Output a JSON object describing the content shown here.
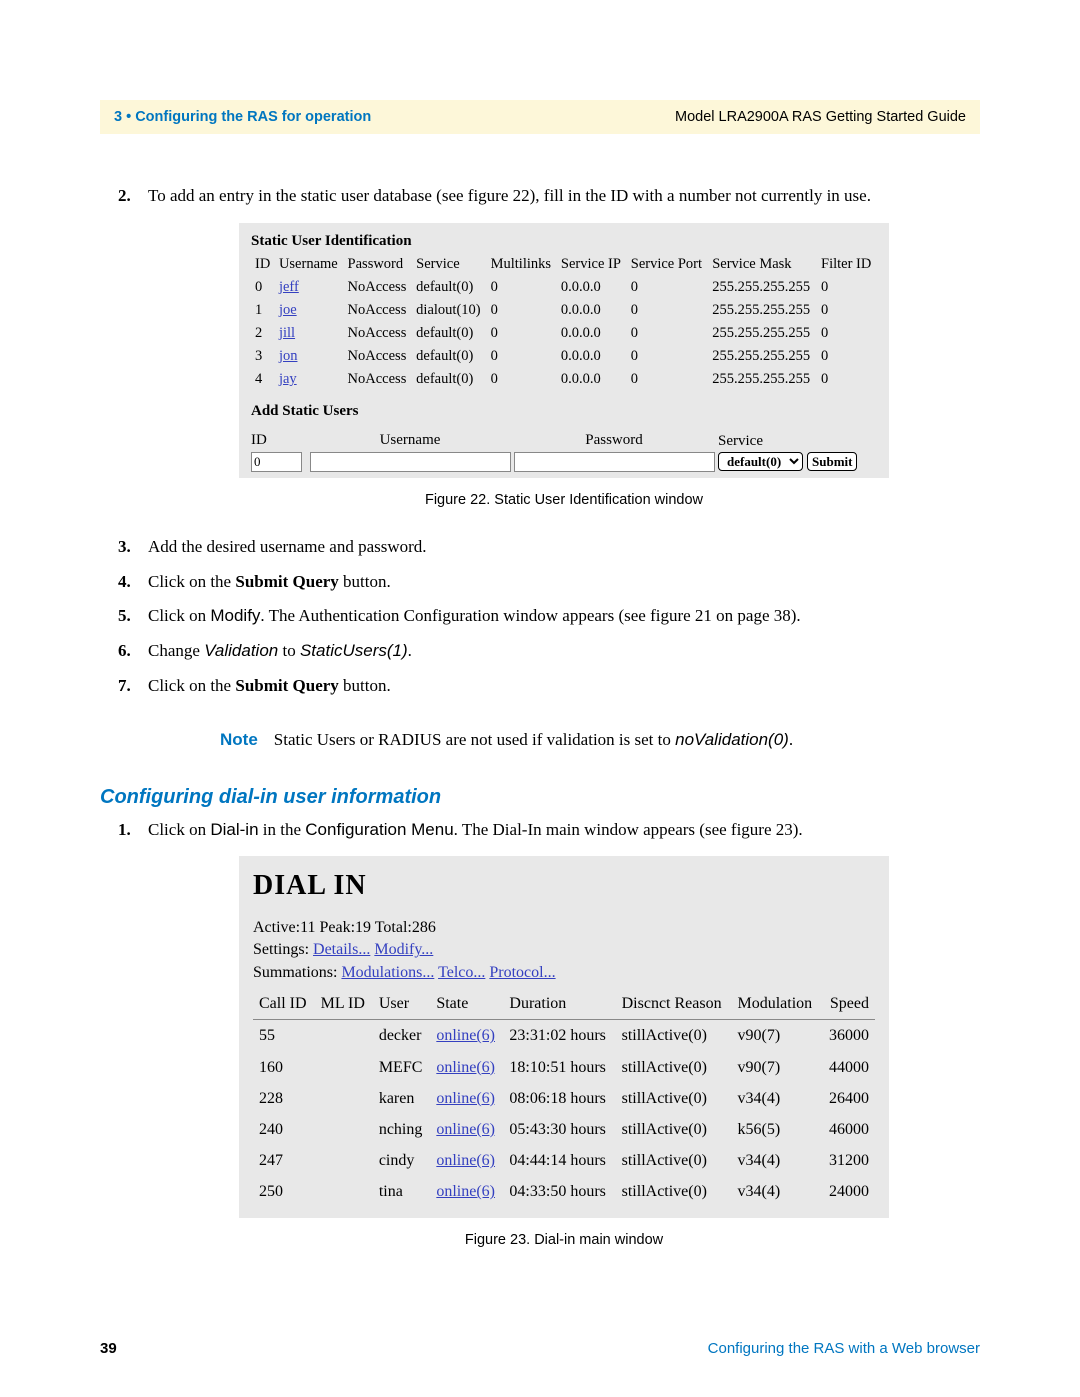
{
  "header": {
    "chapter": "3 • Configuring the RAS for operation",
    "guide": "Model LRA2900A RAS Getting Started Guide"
  },
  "step2_pre": "To add an entry in the static user database (see figure 22), fill in the ID with a number not currently in use.",
  "fig22": {
    "title": "Static User Identification",
    "headers": {
      "id": "ID",
      "user": "Username",
      "pwd": "Password",
      "svc": "Service",
      "ml": "Multilinks",
      "sip": "Service IP",
      "sport": "Service Port",
      "smask": "Service Mask",
      "fid": "Filter ID"
    },
    "rows": [
      {
        "id": "0",
        "user": "jeff",
        "pwd": "NoAccess",
        "svc": "default(0)",
        "ml": "0",
        "sip": "0.0.0.0",
        "sport": "0",
        "smask": "255.255.255.255",
        "fid": "0"
      },
      {
        "id": "1",
        "user": "joe",
        "pwd": "NoAccess",
        "svc": "dialout(10)",
        "ml": "0",
        "sip": "0.0.0.0",
        "sport": "0",
        "smask": "255.255.255.255",
        "fid": "0"
      },
      {
        "id": "2",
        "user": "jill",
        "pwd": "NoAccess",
        "svc": "default(0)",
        "ml": "0",
        "sip": "0.0.0.0",
        "sport": "0",
        "smask": "255.255.255.255",
        "fid": "0"
      },
      {
        "id": "3",
        "user": "jon",
        "pwd": "NoAccess",
        "svc": "default(0)",
        "ml": "0",
        "sip": "0.0.0.0",
        "sport": "0",
        "smask": "255.255.255.255",
        "fid": "0"
      },
      {
        "id": "4",
        "user": "jay",
        "pwd": "NoAccess",
        "svc": "default(0)",
        "ml": "0",
        "sip": "0.0.0.0",
        "sport": "0",
        "smask": "255.255.255.255",
        "fid": "0"
      }
    ],
    "add_title": "Add Static Users",
    "add_labels": {
      "id": "ID",
      "user": "Username",
      "pwd": "Password",
      "svc": "Service"
    },
    "add_id_value": "0",
    "service_option": "default(0)",
    "submit": "Submit",
    "caption": "Figure 22. Static User Identification window"
  },
  "step3": "Add the desired username and password.",
  "step4_a": "Click on the ",
  "step4_b": "Submit Query",
  "step4_c": " button.",
  "step5_a": "Click on ",
  "step5_b": "Modify",
  "step5_c": ". The Authentication Configuration window appears (see figure 21 on page 38).",
  "step6_a": "Change ",
  "step6_b": "Validation",
  "step6_c": " to ",
  "step6_d": "StaticUsers(1)",
  "step6_e": ".",
  "step7_a": "Click on the ",
  "step7_b": "Submit Query",
  "step7_c": " button.",
  "note": {
    "label": "Note",
    "text_a": "Static Users or RADIUS are not used if validation is set to ",
    "text_b": "noValidation(0)",
    "text_c": "."
  },
  "section2": "Configuring dial-in user information",
  "sec2_step1_a": "Click on ",
  "sec2_step1_b": "Dial-in",
  "sec2_step1_c": " in the ",
  "sec2_step1_d": "Configuration Menu",
  "sec2_step1_e": ". The Dial-In main window appears (see figure 23).",
  "fig23": {
    "title": "DIAL IN",
    "active": "Active:11 Peak:19 Total:286",
    "settings_label": "Settings: ",
    "details": "Details...",
    "modify": "Modify...",
    "summ_label": "Summations: ",
    "modulations": "Modulations...",
    "telco": "Telco...",
    "protocol": "Protocol...",
    "headers": {
      "call": "Call ID",
      "ml": "ML ID",
      "user": "User",
      "state": "State",
      "dur": "Duration",
      "reason": "Discnct Reason",
      "mod": "Modulation",
      "speed": "Speed"
    },
    "rows": [
      {
        "call": "55",
        "user": "decker",
        "state": "online(6)",
        "dur": "23:31:02 hours",
        "reason": "stillActive(0)",
        "mod": "v90(7)",
        "speed": "36000"
      },
      {
        "call": "160",
        "user": "MEFC",
        "state": "online(6)",
        "dur": "18:10:51 hours",
        "reason": "stillActive(0)",
        "mod": "v90(7)",
        "speed": "44000"
      },
      {
        "call": "228",
        "user": "karen",
        "state": "online(6)",
        "dur": "08:06:18 hours",
        "reason": "stillActive(0)",
        "mod": "v34(4)",
        "speed": "26400"
      },
      {
        "call": "240",
        "user": "nching",
        "state": "online(6)",
        "dur": "05:43:30 hours",
        "reason": "stillActive(0)",
        "mod": "k56(5)",
        "speed": "46000"
      },
      {
        "call": "247",
        "user": "cindy",
        "state": "online(6)",
        "dur": "04:44:14 hours",
        "reason": "stillActive(0)",
        "mod": "v34(4)",
        "speed": "31200"
      },
      {
        "call": "250",
        "user": "tina",
        "state": "online(6)",
        "dur": "04:33:50 hours",
        "reason": "stillActive(0)",
        "mod": "v34(4)",
        "speed": "24000"
      }
    ],
    "caption": "Figure 23. Dial-in main window"
  },
  "footer": {
    "page": "39",
    "text": "Configuring the RAS with a Web browser"
  }
}
